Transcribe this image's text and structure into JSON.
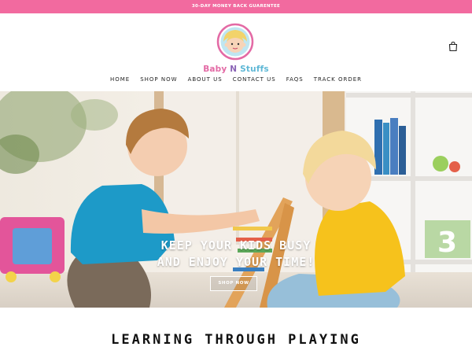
{
  "announcement": {
    "text": "30-DAY MONEY BACK GUARENTEE"
  },
  "brand": {
    "part1": "Baby",
    "part2": "N",
    "part3": "Stuffs"
  },
  "nav": {
    "items": [
      {
        "label": "HOME"
      },
      {
        "label": "SHOP NOW"
      },
      {
        "label": "ABOUT US"
      },
      {
        "label": "CONTACT US"
      },
      {
        "label": "FAQS"
      },
      {
        "label": "TRACK ORDER"
      }
    ]
  },
  "hero": {
    "headline_line1": "KEEP YOUR KIDS BUSY",
    "headline_line2": "AND ENJOY YOUR TIME!",
    "cta_label": "SHOP NOW",
    "block_number": "3"
  },
  "section": {
    "title": "LEARNING THROUGH PLAYING"
  },
  "icons": {
    "cart": "shopping-bag-icon",
    "logo": "baby-face-logo"
  },
  "colors": {
    "announcement_bg": "#f26a9f",
    "logo_pink": "#e36aa5",
    "logo_blue": "#5fb8d6"
  }
}
